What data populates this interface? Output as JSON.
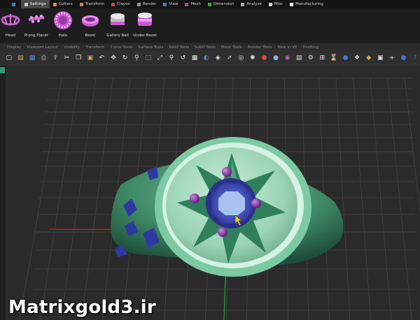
{
  "plugin_tabs": [
    {
      "label": "",
      "color": "#3a85d8",
      "active": false
    },
    {
      "label": "Settings",
      "color": "#c8c8c8",
      "active": true
    },
    {
      "label": "Cutters",
      "color": "#e08a6a",
      "active": false
    },
    {
      "label": "Transform",
      "color": "#e07a58",
      "active": false
    },
    {
      "label": "Clayoo",
      "color": "#d84444",
      "active": false
    },
    {
      "label": "Render",
      "color": "#9a9a9a",
      "active": false
    },
    {
      "label": "View",
      "color": "#5a78c8",
      "active": false
    },
    {
      "label": "Mesh",
      "color": "#b04a96",
      "active": false
    },
    {
      "label": "Dimension",
      "color": "#42a848",
      "active": false
    },
    {
      "label": "Analyze",
      "color": "#aaaaaa",
      "active": false
    },
    {
      "label": "Misc",
      "color": "#d8d8d8",
      "active": false
    },
    {
      "label": "Manufacturing",
      "color": "#ffffff",
      "active": false
    }
  ],
  "plugin_tools": [
    {
      "label": "Head",
      "icon": "head-icon"
    },
    {
      "label": "Prong Placer",
      "icon": "prong-placer-icon"
    },
    {
      "label": "Halo",
      "icon": "halo-icon"
    },
    {
      "label": "Bezel",
      "icon": "bezel-icon"
    },
    {
      "label": "Gallery Rail",
      "icon": "gallery-rail-icon"
    },
    {
      "label": "Under Bezel",
      "icon": "under-bezel-icon"
    }
  ],
  "rhino_tabs": [
    "Display",
    "Viewport Layout",
    "Visibility",
    "Transform",
    "Curve Tools",
    "Surface Tools",
    "Solid Tools",
    "SubD Tools",
    "Mesh Tools",
    "Render Tools",
    "New in V8",
    "Drafting"
  ],
  "toolbar_icons": [
    {
      "name": "new-icon",
      "glyph": "▢",
      "color": "#e8e8e8"
    },
    {
      "name": "open-icon",
      "glyph": "▤",
      "color": "#d8b04a"
    },
    {
      "name": "save-icon",
      "glyph": "▦",
      "color": "#5a8ad8"
    },
    {
      "name": "print-icon",
      "glyph": "⎙",
      "color": "#cccccc"
    },
    {
      "name": "import-icon",
      "glyph": "⇪",
      "color": "#cccccc"
    },
    {
      "name": "cut-icon",
      "glyph": "✂",
      "color": "#e8e8e8"
    },
    {
      "name": "copy-icon",
      "glyph": "❐",
      "color": "#e8e8e8"
    },
    {
      "name": "paste-icon",
      "glyph": "▣",
      "color": "#d8b04a"
    },
    {
      "name": "undo-icon",
      "glyph": "↶",
      "color": "#e8e8e8"
    },
    {
      "name": "pan-icon",
      "glyph": "✥",
      "color": "#e8e8e8"
    },
    {
      "name": "rotate-view-icon",
      "glyph": "↻",
      "color": "#e8e8e8"
    },
    {
      "name": "zoom-icon",
      "glyph": "⚲",
      "color": "#e8e8e8"
    },
    {
      "name": "zoom-window-icon",
      "glyph": "⬚",
      "color": "#e8e8e8"
    },
    {
      "name": "zoom-extents-icon",
      "glyph": "⤢",
      "color": "#e8e8e8"
    },
    {
      "name": "zoom-selected-icon",
      "glyph": "⚲",
      "color": "#e8e8e8"
    },
    {
      "name": "undo-view-icon",
      "glyph": "↺",
      "color": "#e8e8e8"
    },
    {
      "name": "viewport-layout-icon",
      "glyph": "▦",
      "color": "#e8e8e8"
    },
    {
      "name": "display-mode-icon",
      "glyph": "◐",
      "color": "#5a8ad8"
    },
    {
      "name": "layers-icon",
      "glyph": "◈",
      "color": "#e8e8e8"
    },
    {
      "name": "select-icon",
      "glyph": "➚",
      "color": "#e8e8e8"
    },
    {
      "name": "osnap-icon",
      "glyph": "◎",
      "color": "#e8e8e8"
    },
    {
      "name": "lights-icon",
      "glyph": "✺",
      "color": "#e8e8e8"
    },
    {
      "name": "render-icon",
      "glyph": "●",
      "color": "#d84a4a"
    },
    {
      "name": "materials-icon",
      "glyph": "●",
      "color": "#8ab4e8"
    },
    {
      "name": "color-wheel-icon",
      "glyph": "◉",
      "color": "#d85ab8"
    },
    {
      "name": "properties-icon",
      "glyph": "▤",
      "color": "#e8e8e8"
    },
    {
      "name": "options-icon",
      "glyph": "⚙",
      "color": "#e8e8e8"
    },
    {
      "name": "grid-icon",
      "glyph": "⊞",
      "color": "#e8e8e8"
    },
    {
      "name": "history-icon",
      "glyph": "⌛",
      "color": "#e8e8e8"
    },
    {
      "name": "environment-icon",
      "glyph": "●",
      "color": "#4a78c8"
    },
    {
      "name": "texture-icon",
      "glyph": "❖",
      "color": "#e8e8e8"
    },
    {
      "name": "rendered-view-icon",
      "glyph": "◆",
      "color": "#d8b04a"
    },
    {
      "name": "snapshot-icon",
      "glyph": "▣",
      "color": "#e8e8e8"
    },
    {
      "name": "plugin-manager-icon",
      "glyph": "⟛",
      "color": "#e8e8e8"
    },
    {
      "name": "globe-icon",
      "glyph": "●",
      "color": "#3a7ad8"
    },
    {
      "name": "help-icon",
      "glyph": "?",
      "color": "#3a7ad8"
    }
  ],
  "watermark": "Matrixgold3.ir",
  "colors": {
    "ring_metal": "#8fd0ae",
    "ring_dark": "#3a7f5f",
    "gem_blue": "#3b3fae",
    "prong_purple": "#7a2a92",
    "grid_line": "#454545",
    "axis_red": "#c81e1e",
    "axis_green": "#1e9a3a"
  }
}
